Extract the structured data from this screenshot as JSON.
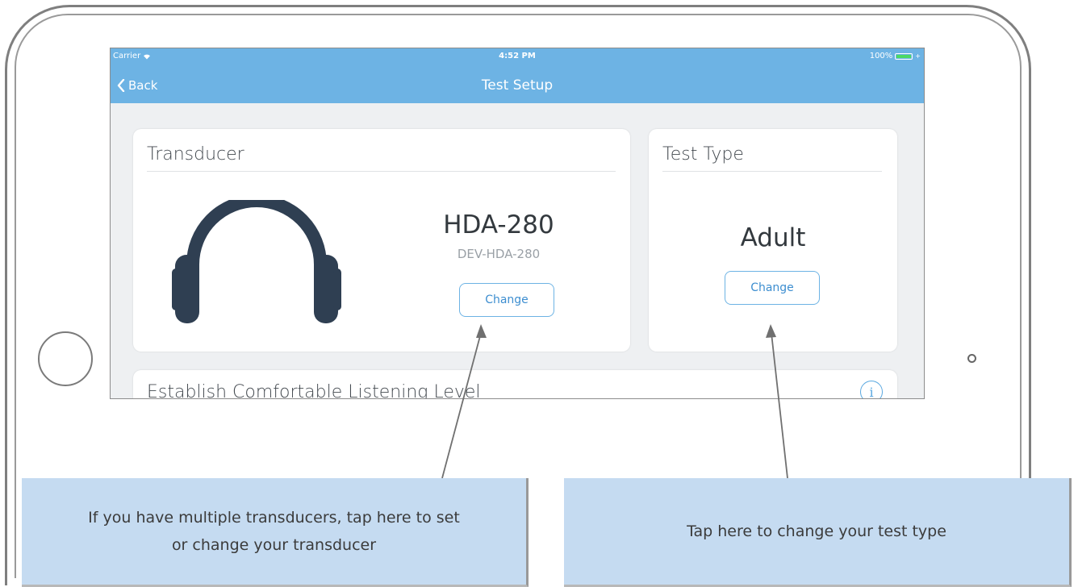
{
  "status_bar": {
    "carrier": "Carrier",
    "time": "4:52 PM",
    "battery": "100%"
  },
  "nav": {
    "back_label": "Back",
    "title": "Test Setup"
  },
  "transducer_card": {
    "title": "Transducer",
    "model": "HDA-280",
    "serial": "DEV-HDA-280",
    "change_label": "Change"
  },
  "test_type_card": {
    "title": "Test Type",
    "value": "Adult",
    "change_label": "Change"
  },
  "listening_card": {
    "title": "Establish Comfortable Listening Level",
    "info_label": "i"
  },
  "callouts": {
    "transducer_text": "If you have multiple transducers, tap here to set or change your transducer",
    "test_type_text": "Tap here to change your test type"
  },
  "colors": {
    "nav_bar": "#6db3e4",
    "accent": "#3d8ed0",
    "callout_bg": "#c5dbf1",
    "headphone": "#2f3f52"
  }
}
